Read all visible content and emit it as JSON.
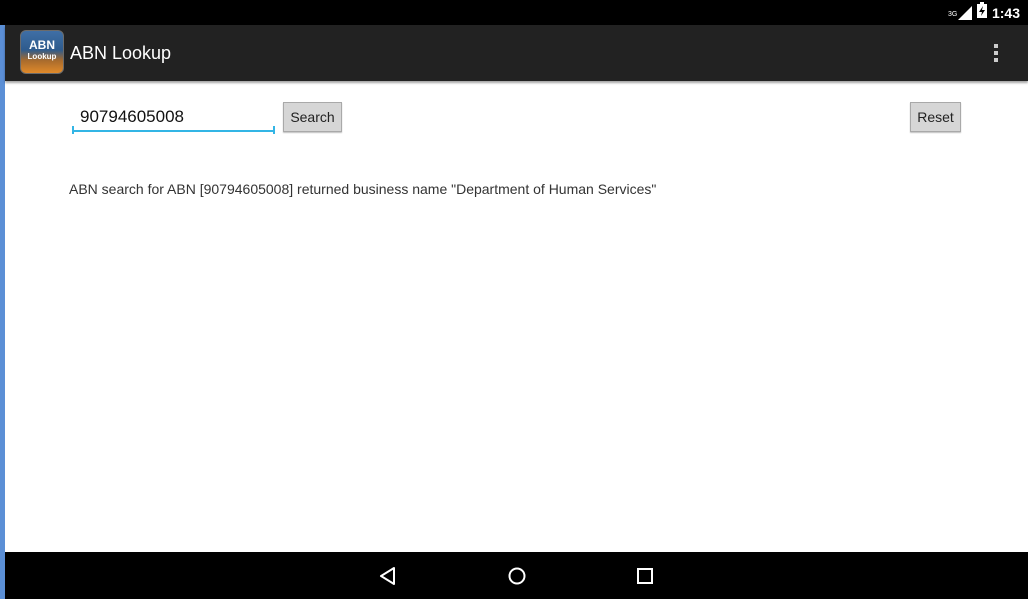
{
  "status_bar": {
    "network": "3G",
    "time": "1:43",
    "icons": [
      "signal-icon",
      "battery-charging-icon"
    ]
  },
  "action_bar": {
    "icon_line1": "ABN",
    "icon_line2": "Lookup",
    "title": "ABN Lookup",
    "overflow_icon": "overflow-menu-icon"
  },
  "search": {
    "value": "90794605008",
    "search_label": "Search",
    "reset_label": "Reset"
  },
  "result": {
    "text": "ABN search for ABN [90794605008] returned business name \"Department of Human Services\""
  },
  "nav_bar": {
    "icons": [
      "back-icon",
      "home-icon",
      "recents-icon"
    ]
  },
  "colors": {
    "accent": "#33b5e5",
    "action_bar": "#222222",
    "button": "#d6d6d6"
  }
}
